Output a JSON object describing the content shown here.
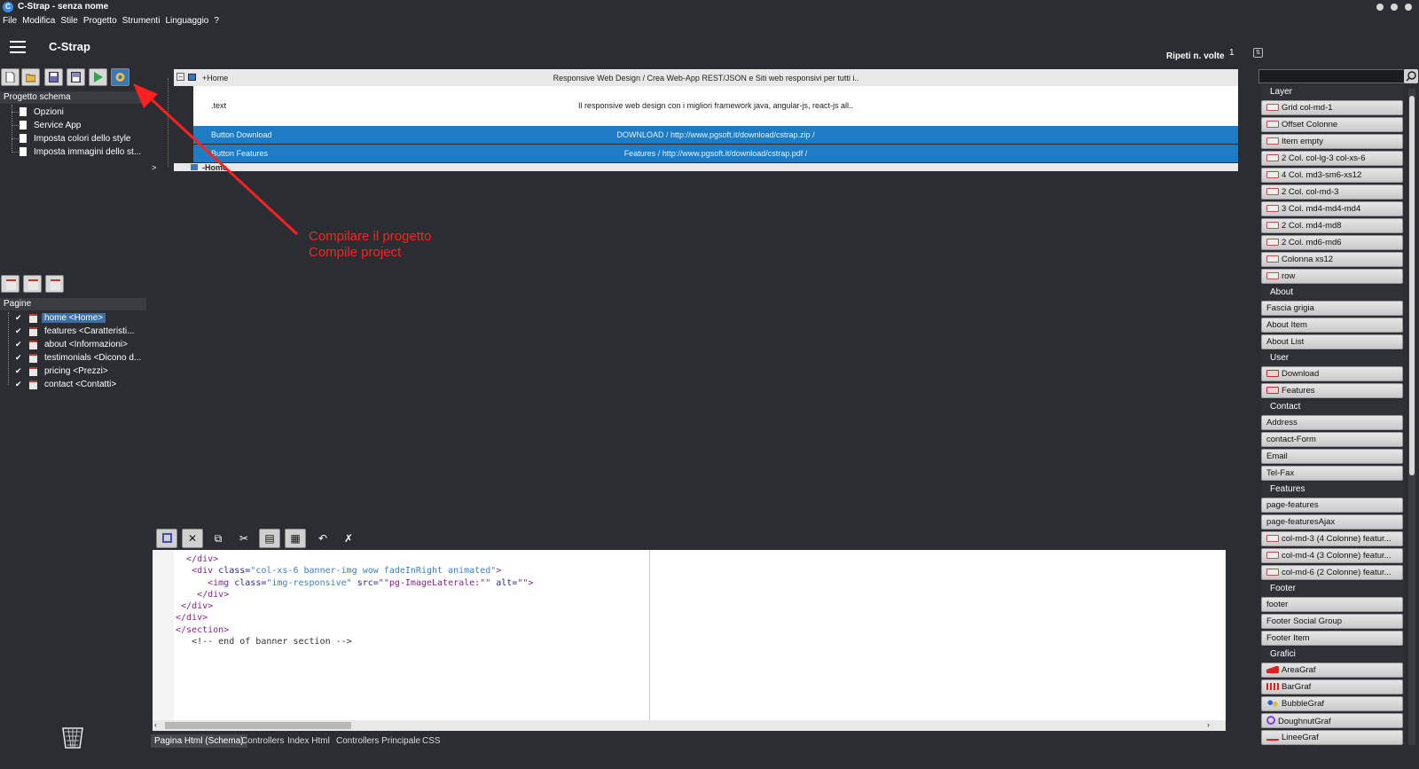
{
  "window": {
    "title": "C-Strap - senza nome"
  },
  "menu": [
    "File",
    "Modifica",
    "Stile",
    "Progetto",
    "Strumenti",
    "Linguaggio",
    "?"
  ],
  "header": {
    "app_name": "C-Strap",
    "repeat_label": "Ripeti n. volte",
    "repeat_value": "1"
  },
  "toolbar_icons": [
    "new-file-icon",
    "open-folder-icon",
    "save-icon",
    "save-as-icon",
    "run-icon",
    "compile-icon"
  ],
  "project_schema": {
    "title": "Progetto schema",
    "items": [
      "Opzioni",
      "Service App",
      "Imposta colori dello style",
      "Imposta immagini dello st..."
    ]
  },
  "pages": {
    "title": "Pagine",
    "items": [
      "home <Home>",
      "features <Caratteristi...",
      "about <Informazioni>",
      "testimonials <Dicono d...",
      "pricing <Prezzi>",
      "contact <Contatti>"
    ]
  },
  "schema": {
    "home_label": "+Home",
    "home_value": "Responsive Web Design / Crea Web-App REST/JSON e Siti web responsivi per tutti i..",
    "text_label": ".text",
    "text_value": "Il responsive web design con i migliori framework java, angular-js, react-js all..",
    "btn_download_label": "Button Download",
    "btn_download_value": "DOWNLOAD / http://www.pgsoft.it/download/cstrap.zip /",
    "btn_features_label": "Button Features",
    "btn_features_value": "Features / http://www.pgsoft.it/download/cstrap.pdf /",
    "home_close_label": "-Home",
    "expand_marker": ">"
  },
  "annotation": {
    "line1": "Compilare il progetto",
    "line2": "Compile project",
    "color": "#ff2020"
  },
  "code_lines": [
    {
      "indent": 2,
      "parts": [
        [
          "tag",
          "</div>"
        ]
      ]
    },
    {
      "indent": 3,
      "parts": [
        [
          "tag",
          "<div "
        ],
        [
          "attr",
          "class="
        ],
        [
          "val",
          "\"col-xs-6 banner-img wow fadeInRight animated\""
        ],
        [
          "tag",
          ">"
        ]
      ]
    },
    {
      "indent": 6,
      "parts": [
        [
          "tag",
          "<img "
        ],
        [
          "attr",
          "class="
        ],
        [
          "val",
          "\"img-responsive\""
        ],
        [
          "attr",
          " src="
        ],
        [
          "tag",
          "\"\"pg-ImageLaterale:\"\" "
        ],
        [
          "attr",
          "alt="
        ],
        [
          "tag",
          "\"\">"
        ]
      ]
    },
    {
      "indent": 4,
      "parts": [
        [
          "tag",
          "</div>"
        ]
      ]
    },
    {
      "indent": 1,
      "parts": [
        [
          "tag",
          "</div>"
        ]
      ]
    },
    {
      "indent": 0,
      "parts": [
        [
          "tag",
          "</div>"
        ]
      ]
    },
    {
      "indent": 0,
      "parts": [
        [
          "tag",
          "</section>"
        ]
      ]
    },
    {
      "indent": 3,
      "parts": [
        [
          "cmt",
          "<!-- end of banner section -->"
        ]
      ]
    }
  ],
  "bottom_tabs": [
    "Pagina Html (Schema)",
    "Controllers",
    "Index Html",
    "Controllers Principale",
    "CSS"
  ],
  "palette": [
    {
      "type": "cat",
      "label": "Layer"
    },
    {
      "type": "btn",
      "label": "Grid col-md-1",
      "icon": "grid-icon"
    },
    {
      "type": "btn",
      "label": "Offset Colonne",
      "icon": "grid-icon"
    },
    {
      "type": "btn",
      "label": "Item empty",
      "icon": "grid-icon"
    },
    {
      "type": "btn",
      "label": "2 Col. col-lg-3 col-xs-6",
      "icon": "grid-icon"
    },
    {
      "type": "btn",
      "label": "4 Col. md3-sm6-xs12",
      "icon": "grid-icon"
    },
    {
      "type": "btn",
      "label": "2 Col. col-md-3",
      "icon": "grid-icon"
    },
    {
      "type": "btn",
      "label": "3 Col. md4-md4-md4",
      "icon": "grid-icon"
    },
    {
      "type": "btn",
      "label": "2 Col. md4-md8",
      "icon": "grid-icon"
    },
    {
      "type": "btn",
      "label": "2 Col. md6-md6",
      "icon": "grid-icon"
    },
    {
      "type": "btn",
      "label": "Colonna xs12",
      "icon": "grid-icon"
    },
    {
      "type": "btn",
      "label": "row",
      "icon": "grid-icon"
    },
    {
      "type": "cat",
      "label": "About"
    },
    {
      "type": "btn",
      "label": "Fascia grigia"
    },
    {
      "type": "btn",
      "label": "About Item"
    },
    {
      "type": "btn",
      "label": "About List"
    },
    {
      "type": "cat",
      "label": "User"
    },
    {
      "type": "btn",
      "label": "Download",
      "icon": "button-icon"
    },
    {
      "type": "btn",
      "label": "Features",
      "icon": "button-icon"
    },
    {
      "type": "cat",
      "label": "Contact"
    },
    {
      "type": "btn",
      "label": "Address"
    },
    {
      "type": "btn",
      "label": "contact-Form"
    },
    {
      "type": "btn",
      "label": "Email"
    },
    {
      "type": "btn",
      "label": "Tel-Fax"
    },
    {
      "type": "cat",
      "label": "Features"
    },
    {
      "type": "btn",
      "label": "page-features"
    },
    {
      "type": "btn",
      "label": "page-featuresAjax"
    },
    {
      "type": "btn",
      "label": "col-md-3 (4 Colonne) featur...",
      "icon": "grid-icon"
    },
    {
      "type": "btn",
      "label": "col-md-4 (3 Colonne) featur...",
      "icon": "grid-icon"
    },
    {
      "type": "btn",
      "label": "col-md-6 (2 Colonne) featur...",
      "icon": "grid-icon"
    },
    {
      "type": "cat",
      "label": "Footer"
    },
    {
      "type": "btn",
      "label": "footer"
    },
    {
      "type": "btn",
      "label": "Footer Social Group"
    },
    {
      "type": "btn",
      "label": "Footer Item"
    },
    {
      "type": "cat",
      "label": "Grafici"
    },
    {
      "type": "btn",
      "label": "AreaGraf",
      "icon": "area-chart-icon"
    },
    {
      "type": "btn",
      "label": "BarGraf",
      "icon": "bar-chart-icon"
    },
    {
      "type": "btn",
      "label": "BubbleGraf",
      "icon": "bubble-chart-icon"
    },
    {
      "type": "btn",
      "label": "DoughnutGraf",
      "icon": "doughnut-chart-icon"
    },
    {
      "type": "btn",
      "label": "LineeGraf",
      "icon": "line-chart-icon"
    }
  ],
  "colors": {
    "background": "#2b2d33",
    "selection": "#1e7cc5",
    "annotation": "#ff2020",
    "panel_button": "#d8d8d8"
  }
}
